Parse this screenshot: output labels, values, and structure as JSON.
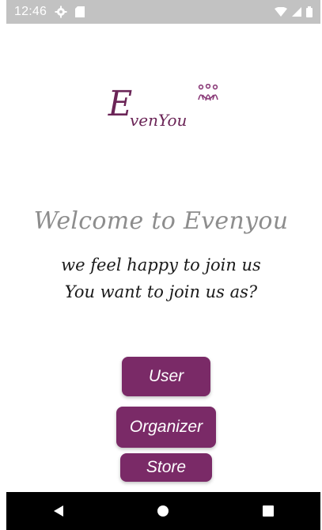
{
  "status_bar": {
    "time": "12:46",
    "icons": [
      "settings-icon",
      "sd-card-icon",
      "wifi-icon",
      "signal-icon",
      "battery-icon"
    ]
  },
  "logo": {
    "big_letter": "E",
    "small_text": "venYou",
    "color": "#6b2557"
  },
  "welcome": {
    "title": "Welcome to Evenyou",
    "line1": "we feel happy to join us",
    "line2": "You want to join us as?"
  },
  "buttons": {
    "user": "User",
    "organizer": "Organizer",
    "store": "Store",
    "color": "#7a2a67"
  },
  "nav_bar": {
    "icons": [
      "back-icon",
      "home-icon",
      "recents-icon"
    ]
  }
}
